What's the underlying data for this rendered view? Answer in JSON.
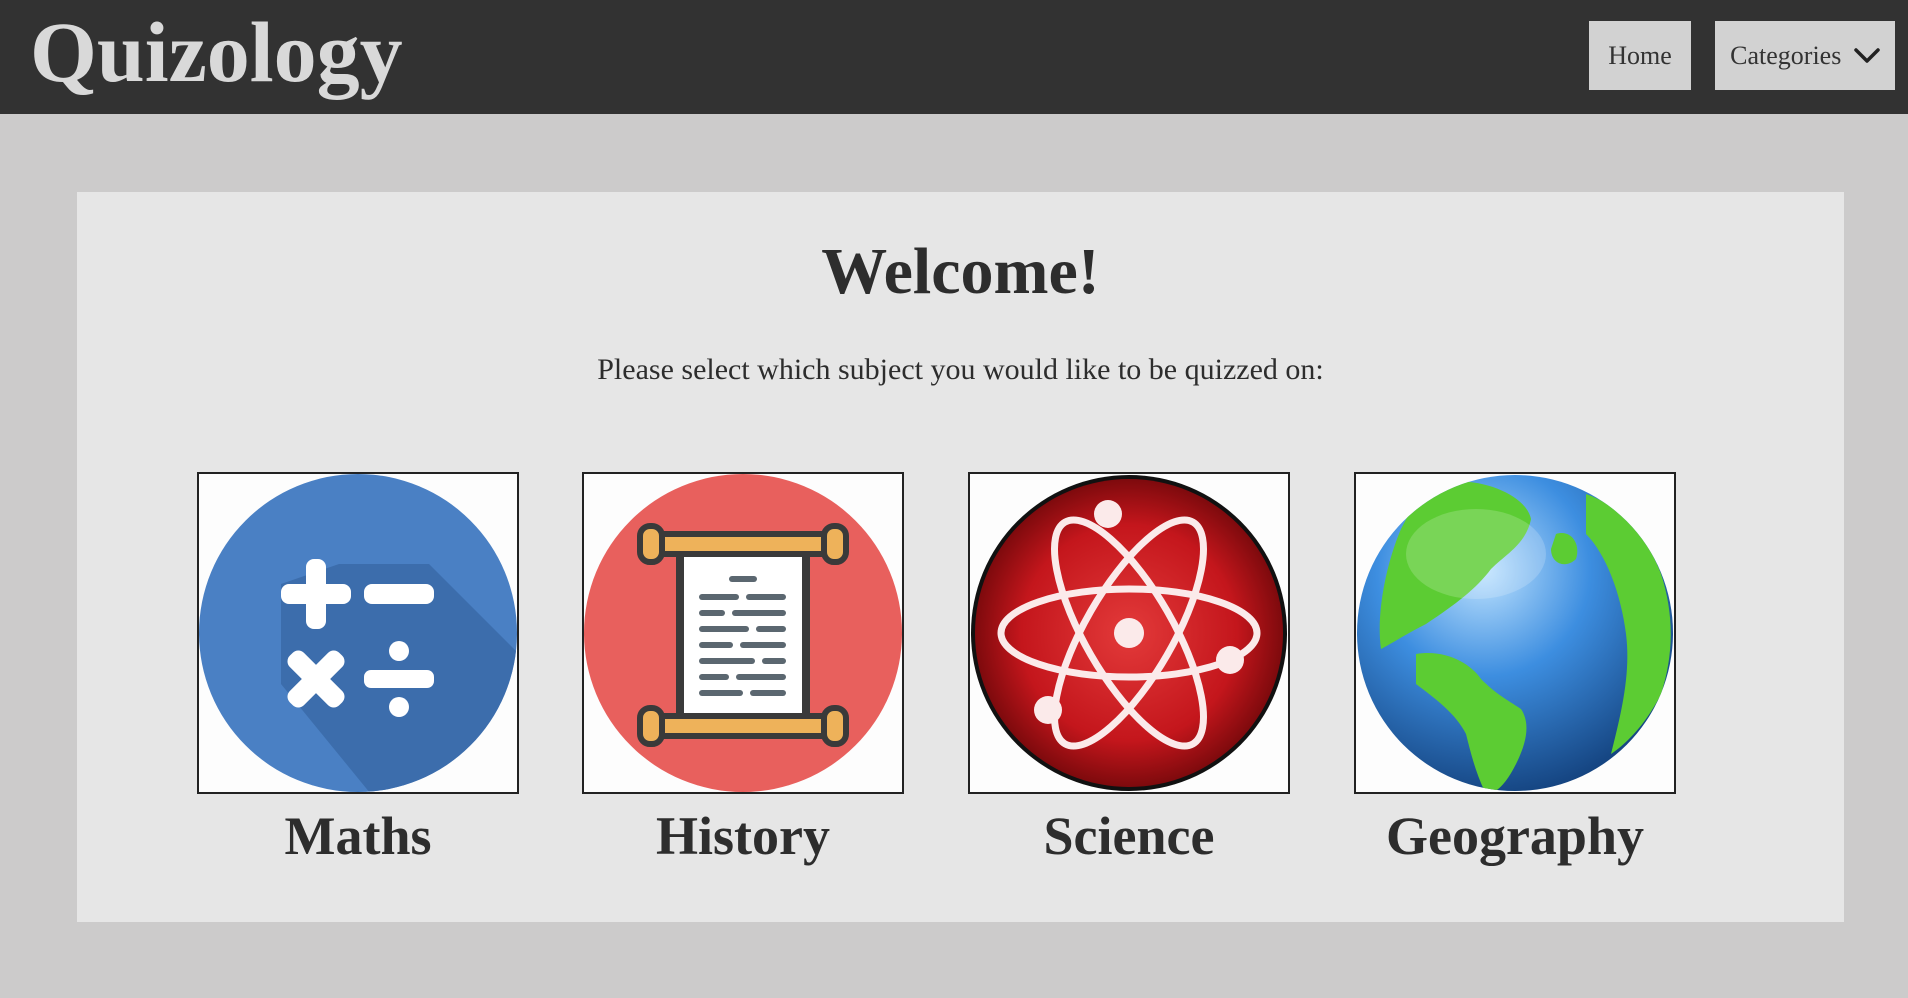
{
  "header": {
    "brand": "Quizology",
    "nav": {
      "home_label": "Home",
      "categories_label": "Categories",
      "categories_icon": "chevron-down-icon"
    }
  },
  "main": {
    "title": "Welcome!",
    "subtitle": "Please select which subject you would like to be quizzed on:",
    "subjects": [
      {
        "label": "Maths",
        "icon": "math-operators-icon",
        "color": "#4a80c4"
      },
      {
        "label": "History",
        "icon": "scroll-icon",
        "color": "#e8605d"
      },
      {
        "label": "Science",
        "icon": "atom-icon",
        "color": "#c4161c"
      },
      {
        "label": "Geography",
        "icon": "globe-icon",
        "color": "#2f7fd6"
      }
    ]
  },
  "colors": {
    "header_bg": "#323232",
    "page_bg": "#cccbcb",
    "panel_bg": "#e6e6e6",
    "nav_button_bg": "#d2d2d2"
  }
}
